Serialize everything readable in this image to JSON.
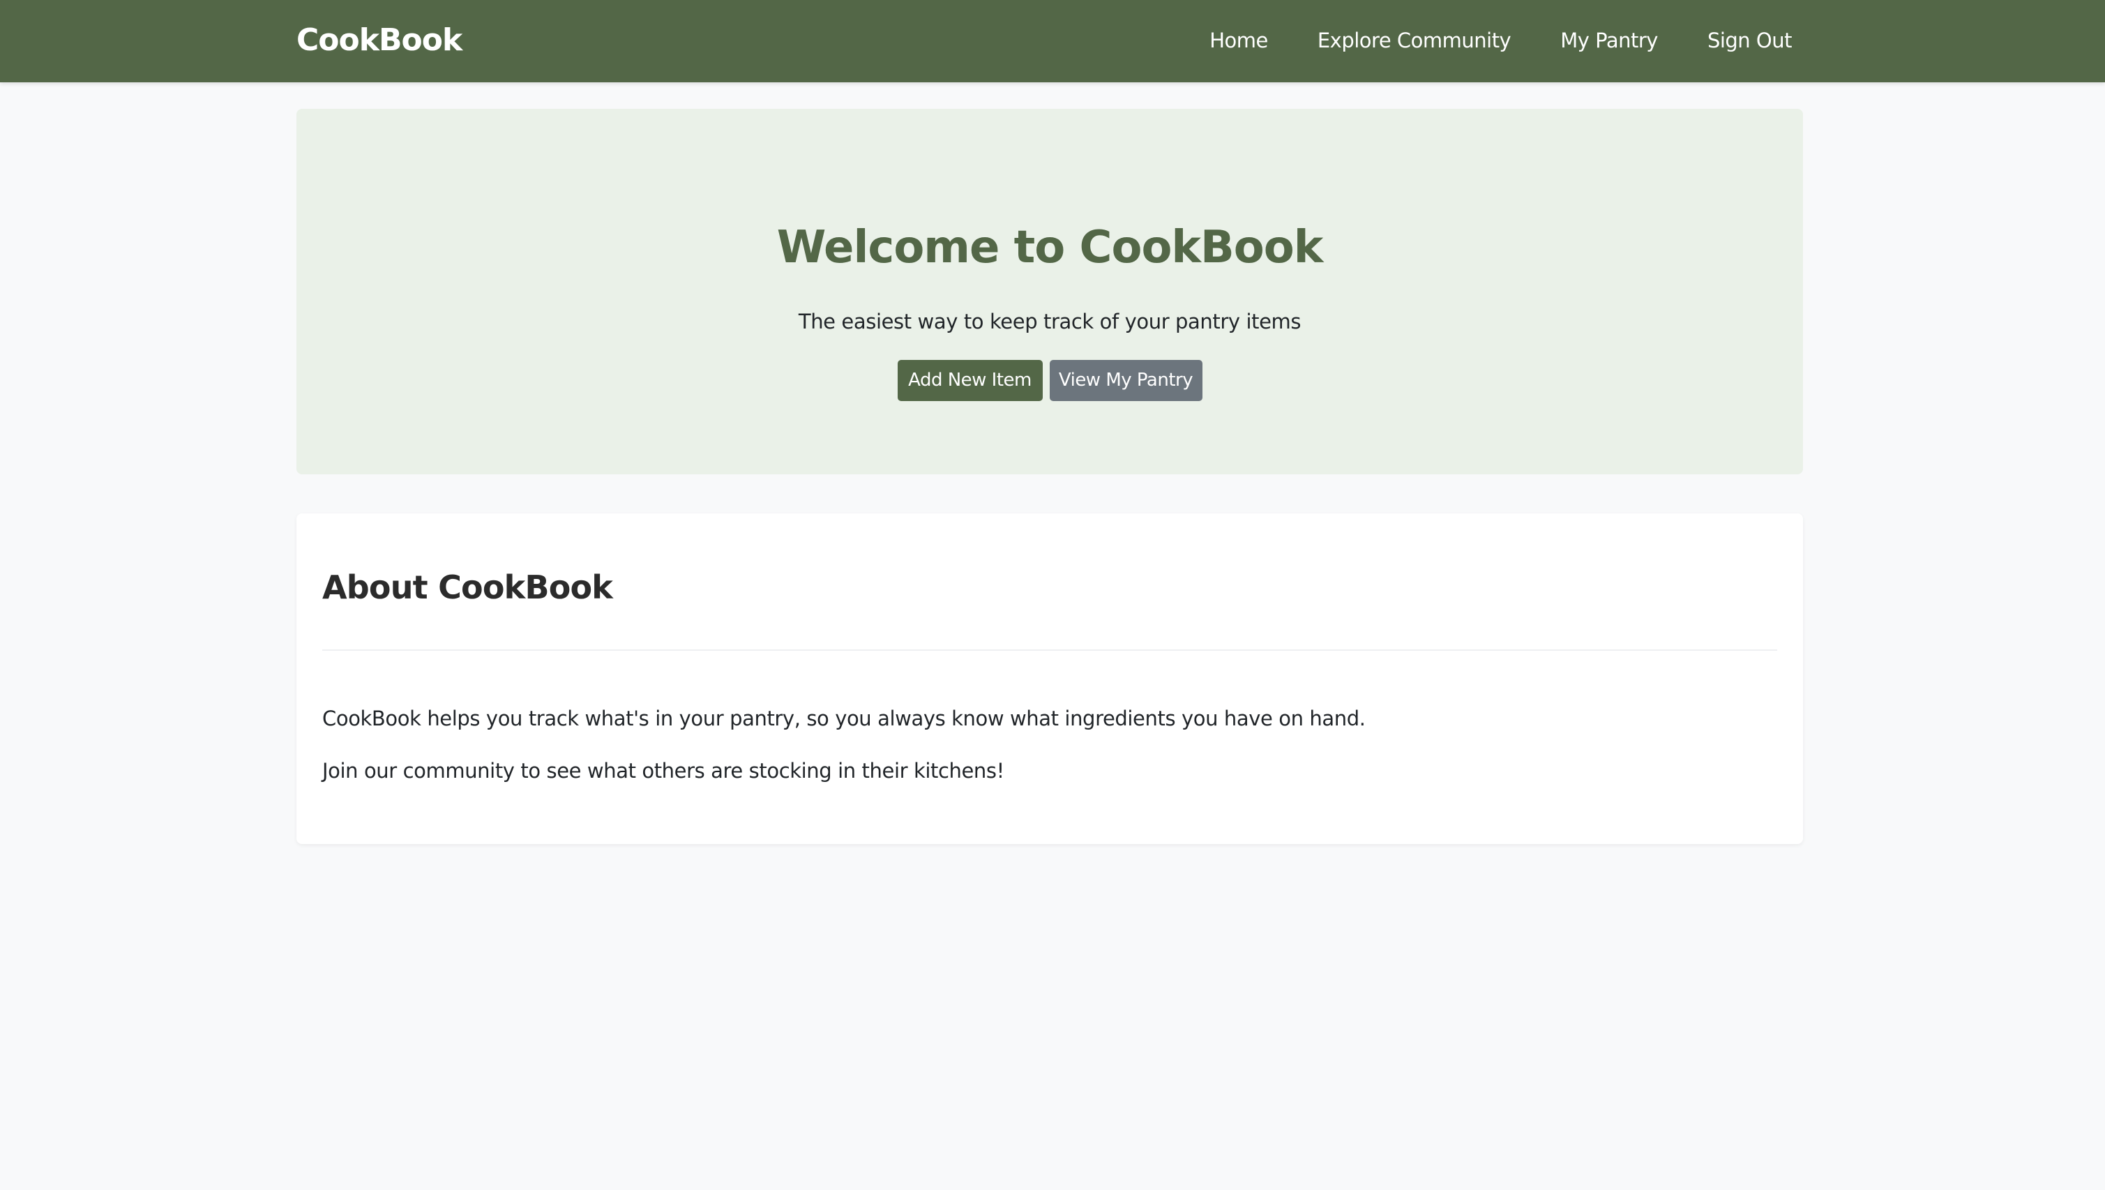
{
  "navbar": {
    "brand": "CookBook",
    "links": [
      {
        "label": "Home"
      },
      {
        "label": "Explore Community"
      },
      {
        "label": "My Pantry"
      },
      {
        "label": "Sign Out"
      }
    ]
  },
  "hero": {
    "title": "Welcome to CookBook",
    "subtitle": "The easiest way to keep track of your pantry items",
    "primary_button": "Add New Item",
    "secondary_button": "View My Pantry"
  },
  "about": {
    "title": "About CookBook",
    "paragraphs": [
      "CookBook helps you track what's in your pantry, so you always know what ingredients you have on hand.",
      "Join our community to see what others are stocking in their kitchens!"
    ]
  },
  "colors": {
    "brand_green": "#536747",
    "hero_background": "#eaf1e8",
    "secondary_button": "#6c757d",
    "page_background": "#f8f9fa"
  }
}
